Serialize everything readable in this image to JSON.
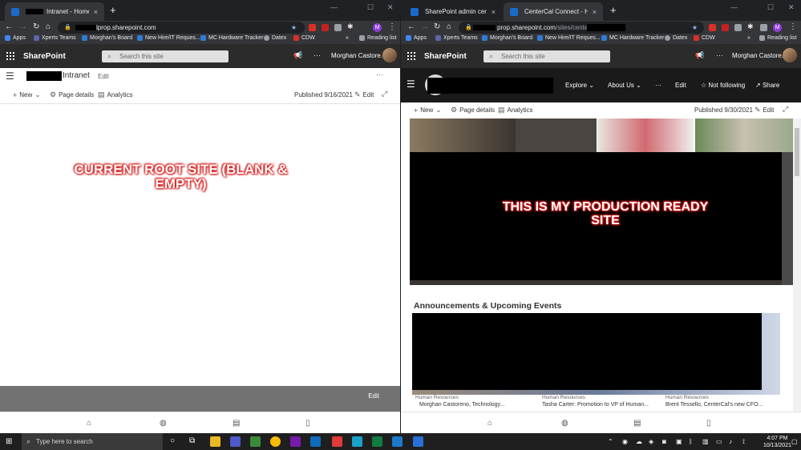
{
  "left_window": {
    "tabs": [
      {
        "title": "Intranet - Home",
        "close": "×",
        "active": true
      }
    ],
    "new_tab": "+",
    "window_controls": [
      "—",
      "☐",
      "✕"
    ],
    "url": "lprop.sharepoint.com",
    "bookmarks": [
      "Apps",
      "Xperts Teams",
      "Morghan's Board",
      "New Hire/IT Reques...",
      "MC Hardware Tracker",
      "Datex",
      "CDW",
      "»",
      "Reading list"
    ],
    "suite": {
      "brand": "SharePoint",
      "search_placeholder": "Search this site",
      "user": "Morghan Castore..."
    },
    "site": {
      "name": "Intranet",
      "edit": "Edit",
      "more": "···"
    },
    "commands": {
      "new": "New",
      "page_details": "Page details",
      "analytics": "Analytics",
      "published": "Published 9/16/2021",
      "edit": "Edit"
    },
    "overlay_text": "CURRENT ROOT SITE (BLANK & EMPTY)",
    "edit_bar": "Edit"
  },
  "right_window": {
    "tabs": [
      {
        "title": "SharePoint admin center",
        "close": "×",
        "active": false
      },
      {
        "title": "CenterCal Connect - Home",
        "close": "×",
        "active": true
      }
    ],
    "new_tab": "+",
    "window_controls": [
      "—",
      "☐",
      "✕"
    ],
    "url": "prop.sharepoint.com",
    "url_path": "/sites/centerc",
    "bookmarks": [
      "Apps",
      "Xperts Teams",
      "Morghan's Board",
      "New Hire/IT Reques...",
      "MC Hardware Tracker",
      "Datex",
      "CDW",
      "»",
      "Reading list"
    ],
    "suite": {
      "brand": "SharePoint",
      "search_placeholder": "Search this site",
      "user": "Morghan Castore..."
    },
    "site_nav": {
      "explore": "Explore",
      "about_us": "About Us",
      "more": "···",
      "edit": "Edit",
      "follow": "Not following",
      "share": "Share"
    },
    "commands": {
      "new": "New",
      "page_details": "Page details",
      "analytics": "Analytics",
      "published": "Published 9/30/2021",
      "edit": "Edit"
    },
    "overlay_text_line1": "THIS IS MY PRODUCTION READY",
    "overlay_text_line2": "SITE",
    "section_title": "Announcements & Upcoming Events",
    "news": [
      {
        "category": "Human Resources",
        "title": "Morghan Castoreno, Technology..."
      },
      {
        "category": "Human Resources",
        "title": "Tasha Carter: Promotion to VP of Human..."
      },
      {
        "category": "Human Resources",
        "title": "Brent Tessello, CenterCal's new CFO..."
      }
    ]
  },
  "taskbar": {
    "search_placeholder": "Type here to search",
    "time": "4:07 PM",
    "date": "10/13/2021"
  },
  "colors": {
    "chrome_dark": "#202124",
    "suite_bar": "#2b2b2b",
    "overlay_red": "#e02727",
    "taskbar": "#1f1f1f"
  }
}
